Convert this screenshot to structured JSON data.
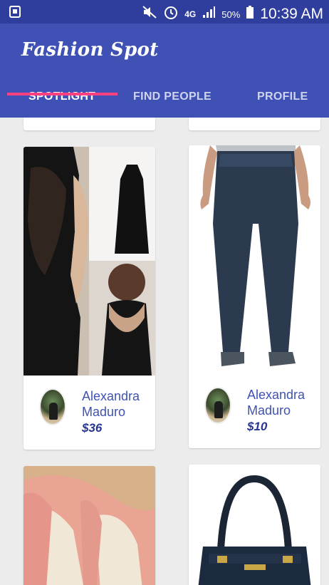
{
  "status_bar": {
    "network": "4G",
    "battery_percent": "50%",
    "time": "10:39 AM"
  },
  "app": {
    "title": "Fashion Spot"
  },
  "tabs": [
    {
      "label": "SPOTLIGHT",
      "active": true
    },
    {
      "label": "FIND PEOPLE",
      "active": false
    },
    {
      "label": "PROFILE",
      "active": false
    }
  ],
  "colors": {
    "primary": "#3f51b5",
    "primary_dark": "#2f3e9c",
    "accent": "#ff4081",
    "background": "#ececec"
  },
  "products": [
    {
      "seller": "Alexandra Maduro",
      "price": "$36",
      "image": "black-lace-dress"
    },
    {
      "seller": "Alexandra Maduro",
      "price": "$10",
      "image": "denim-jeans"
    },
    {
      "image": "pink-knit-shoes"
    },
    {
      "image": "navy-handbag"
    }
  ]
}
